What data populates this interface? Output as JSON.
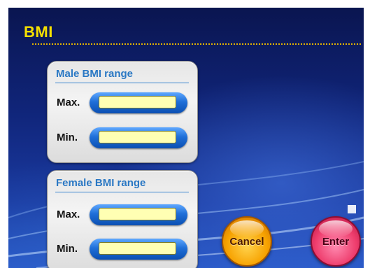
{
  "screen": {
    "title": "BMI"
  },
  "male": {
    "heading": "Male BMI range",
    "max_label": "Max.",
    "max_value": "",
    "min_label": "Min.",
    "min_value": ""
  },
  "female": {
    "heading": "Female BMI range",
    "max_label": "Max.",
    "max_value": "",
    "min_label": "Min.",
    "min_value": ""
  },
  "actions": {
    "cancel_label": "Cancel",
    "enter_label": "Enter"
  },
  "colors": {
    "title": "#f5e000",
    "heading": "#2a78c4",
    "input_fill": "#ffffb3",
    "cancel": "#f7a200",
    "enter": "#ee3d6d"
  }
}
